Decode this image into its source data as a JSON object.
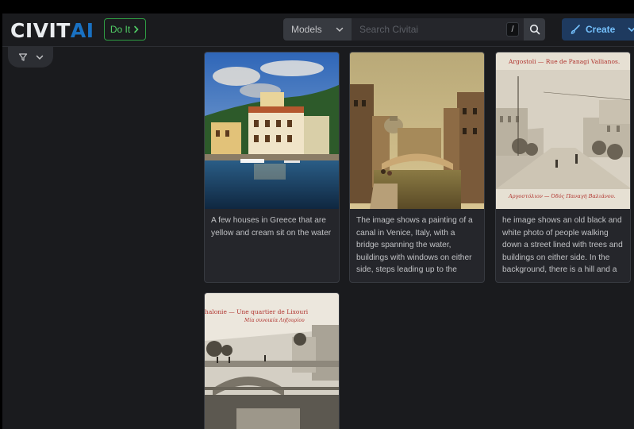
{
  "header": {
    "logo_part1": "CIVIT",
    "logo_part2": "AI",
    "do_it_label": "Do It",
    "model_select_value": "Models",
    "search_placeholder": "Search Civitai",
    "search_shortcut": "/",
    "create_label": "Create"
  },
  "cards": [
    {
      "caption": "A few houses in Greece that are yellow and cream sit on the water"
    },
    {
      "caption": "The image shows a painting of a canal in Venice, Italy, with a bridge spanning the water, buildings with windows on either side, steps leading up to the bridge, and a few people walking along the"
    },
    {
      "caption": "he image shows an old black and white photo of people walking down a street lined with trees and buildings on either side. In the background, there is a hill and a church at the bottom of the"
    },
    {
      "caption": ""
    }
  ],
  "postcards": {
    "argostoli_title": "Argostoli — Rue de Panagi Vallianos.",
    "argostoli_subtitle": "Αργοστόλιον — Όδός Παναγή Βαλιάνου.",
    "lixouri_title": "halonie — Une quartier de Lixouri",
    "lixouri_subtitle": "Μία συνοικία Ληξουρίου"
  },
  "icons": {
    "do_it": "chevron-right-icon",
    "model_select": "chevron-down-icon",
    "search": "search-icon",
    "create": "brush-icon",
    "create_chevron": "chevron-down-icon",
    "filter": "filter-icon",
    "filter_chevron": "chevron-down-icon"
  },
  "colors": {
    "background": "#1a1b1e",
    "card": "#25262b",
    "brand_blue": "#1971c2",
    "do_it_green": "#51cf66",
    "create_text": "#74c0fc"
  }
}
